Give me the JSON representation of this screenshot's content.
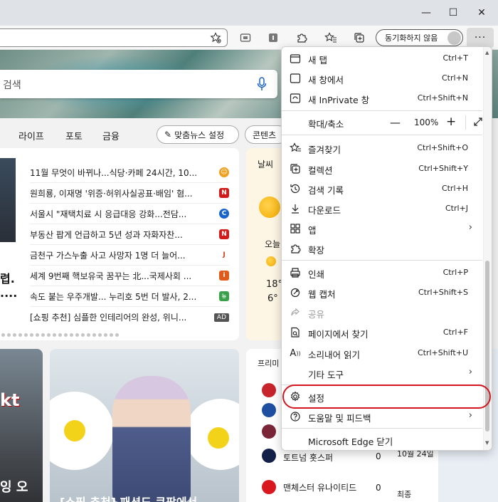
{
  "window": {
    "minimize": "—",
    "maximize": "☐",
    "close": "✕"
  },
  "toolbar": {
    "sync_label": "동기화하지 않음",
    "more_label": "···"
  },
  "page": {
    "search_placeholder": "검색",
    "nav": [
      "라이프",
      "포토",
      "금융"
    ],
    "pill_news": "맞춤뉴스 설정",
    "pill_contents": "콘텐츠",
    "news": [
      {
        "text": "11월 무엇이 바뀌나...식당·카페 24시간, 10...",
        "color": "#f0a020",
        "badge": "☺"
      },
      {
        "text": "원희룡, 이재명 '위증·허위사실공표·배임' 혐...",
        "color": "#d11a1a",
        "badge": "N"
      },
      {
        "text": "서울시 \"재택치료 시 응급대응 강화...전담...",
        "color": "#1a63c9",
        "badge": "C"
      },
      {
        "text": "부동산 팝게 언급하고 5년 성과 자화자찬...",
        "color": "#d11a1a",
        "badge": "N"
      },
      {
        "text": "금천구 가스누출 사고 사망자 1명 더 늘어...",
        "color": "#d63a1a",
        "badge": "J"
      },
      {
        "text": "세계 9번째 핵보유국 꿈꾸는 北...국제사회 ...",
        "color": "#e05a1a",
        "badge": "i"
      },
      {
        "text": "속도 붙는 우주개발... 누리호 5번 더 발사, 2...",
        "color": "#3aa04a",
        "badge": "뉴"
      },
      {
        "text": "[쇼핑 추천] 심플한 인테리어의 완성, 위니...",
        "color": "#555555",
        "badge": "AD"
      }
    ],
    "news_left_big": "렵.",
    "news_left_dots": "....",
    "weather": {
      "title": "날씨",
      "today": "오늘",
      "temp_hi": "18°",
      "temp_lo": "6°"
    },
    "imgcard1_text": "잉 오",
    "imgcard1_logo": "kt",
    "imgcard2_caption": "[쇼핑 추천] 패션도 쿠팡에서",
    "premier": {
      "title": "프리미",
      "rows": [
        {
          "team": "",
          "score": "",
          "date": "",
          "color": "#c7242b"
        },
        {
          "team": "",
          "score": "",
          "date": "",
          "color": "#1e4fa0"
        },
        {
          "team": "",
          "score": "",
          "date": "",
          "color": "#7a2638"
        },
        {
          "team": "토트넘 홋스퍼",
          "score": "0",
          "date": "10월 24일",
          "color": "#13214a"
        },
        {
          "team": "맨체스터 유나이티드",
          "score": "0",
          "date": "최종",
          "color": "#d8181e"
        }
      ]
    }
  },
  "menu": {
    "new_tab": {
      "label": "새 탭",
      "shortcut": "Ctrl+T"
    },
    "new_window": {
      "label": "새 창에서",
      "shortcut": "Ctrl+N"
    },
    "new_inprivate": {
      "label": "새 InPrivate 창",
      "shortcut": "Ctrl+Shift+N"
    },
    "zoom": {
      "label": "확대/축소",
      "minus": "—",
      "value": "100%",
      "plus": "+"
    },
    "favorites": {
      "label": "즐겨찾기",
      "shortcut": "Ctrl+Shift+O"
    },
    "collections": {
      "label": "컬렉션",
      "shortcut": "Ctrl+Shift+Y"
    },
    "history": {
      "label": "검색 기록",
      "shortcut": "Ctrl+H"
    },
    "downloads": {
      "label": "다운로드",
      "shortcut": "Ctrl+J"
    },
    "apps": {
      "label": "앱",
      "chevron": "›"
    },
    "extensions": {
      "label": "확장"
    },
    "print": {
      "label": "인쇄",
      "shortcut": "Ctrl+P"
    },
    "web_capture": {
      "label": "웹 캡처",
      "shortcut": "Ctrl+Shift+S"
    },
    "share": {
      "label": "공유"
    },
    "find": {
      "label": "페이지에서 찾기",
      "shortcut": "Ctrl+F"
    },
    "read_aloud": {
      "label": "소리내어 읽기",
      "shortcut": "Ctrl+Shift+U"
    },
    "more_tools": {
      "label": "기타 도구",
      "chevron": "›"
    },
    "settings": {
      "label": "설정"
    },
    "help": {
      "label": "도움말 및 피드백",
      "chevron": "›"
    },
    "close_edge": {
      "label": "Microsoft Edge 닫기"
    }
  },
  "colors": {
    "highlight": "#d4141e",
    "accent": "#0067c0"
  }
}
